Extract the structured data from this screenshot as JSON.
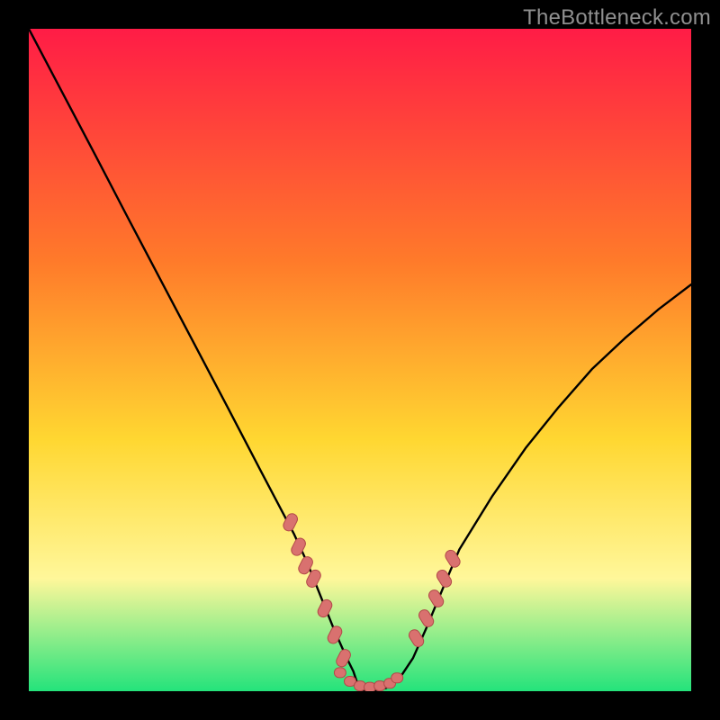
{
  "watermark": "TheBottleneck.com",
  "colors": {
    "bg": "#000000",
    "gradient_top": "#ff1c46",
    "gradient_mid1": "#ff7a2a",
    "gradient_mid2": "#ffd731",
    "gradient_mid3": "#fff79a",
    "gradient_bottom": "#24e37b",
    "curve": "#000000",
    "dot_fill": "#d9716f",
    "dot_stroke": "#b24a49"
  },
  "chart_data": {
    "type": "line",
    "title": "",
    "xlabel": "",
    "ylabel": "",
    "x": [
      0.0,
      0.05,
      0.1,
      0.15,
      0.2,
      0.25,
      0.3,
      0.35,
      0.38,
      0.4,
      0.42,
      0.44,
      0.46,
      0.48,
      0.49,
      0.5,
      0.52,
      0.54,
      0.56,
      0.58,
      0.6,
      0.63,
      0.65,
      0.7,
      0.75,
      0.8,
      0.85,
      0.9,
      0.95,
      1.0
    ],
    "values": [
      1.0,
      0.905,
      0.81,
      0.714,
      0.619,
      0.524,
      0.429,
      0.333,
      0.276,
      0.238,
      0.195,
      0.145,
      0.095,
      0.05,
      0.03,
      0.0,
      0.0,
      0.005,
      0.02,
      0.05,
      0.095,
      0.167,
      0.214,
      0.295,
      0.367,
      0.429,
      0.486,
      0.533,
      0.576,
      0.614
    ],
    "ylim": [
      0,
      1
    ],
    "xlim": [
      0,
      1
    ],
    "markers": {
      "left_branch_x": [
        0.395,
        0.407,
        0.418,
        0.43,
        0.447,
        0.462,
        0.475
      ],
      "left_branch_y": [
        0.255,
        0.218,
        0.19,
        0.17,
        0.125,
        0.085,
        0.05
      ],
      "trough_x": [
        0.47,
        0.485,
        0.5,
        0.515,
        0.53,
        0.545,
        0.556
      ],
      "trough_y": [
        0.028,
        0.015,
        0.008,
        0.006,
        0.008,
        0.012,
        0.02
      ],
      "right_branch_x": [
        0.585,
        0.6,
        0.615,
        0.627,
        0.64
      ],
      "right_branch_y": [
        0.08,
        0.11,
        0.14,
        0.17,
        0.2
      ]
    }
  }
}
